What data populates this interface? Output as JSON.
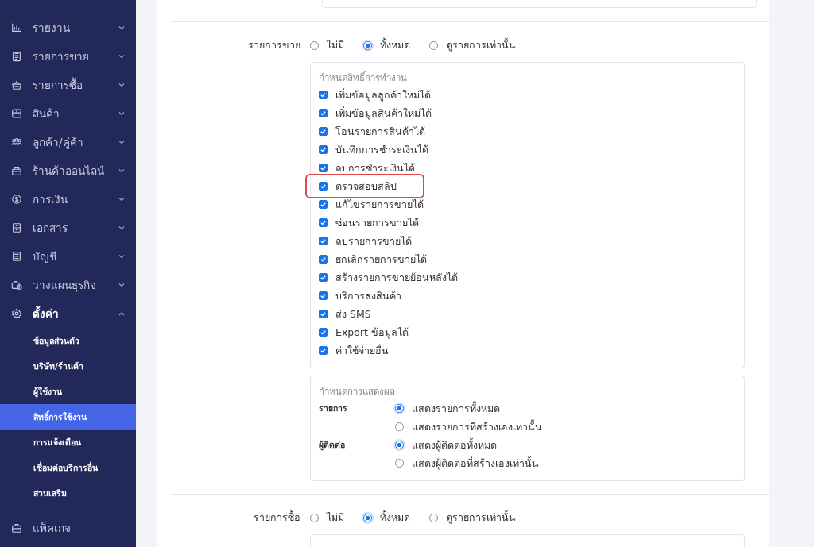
{
  "sidebar": {
    "items": [
      {
        "label": "รายงาน",
        "expanded": false
      },
      {
        "label": "รายการขาย",
        "expanded": false
      },
      {
        "label": "รายการซื้อ",
        "expanded": false
      },
      {
        "label": "สินค้า",
        "expanded": false
      },
      {
        "label": "ลูกค้า/คู่ค้า",
        "expanded": false
      },
      {
        "label": "ร้านค้าออนไลน์",
        "expanded": false
      },
      {
        "label": "การเงิน",
        "expanded": false
      },
      {
        "label": "เอกสาร",
        "expanded": false
      },
      {
        "label": "บัญชี",
        "expanded": false
      },
      {
        "label": "วางแผนธุรกิจ",
        "expanded": false
      },
      {
        "label": "ตั้งค่า",
        "expanded": true,
        "children": [
          {
            "label": "ข้อมูลส่วนตัว",
            "selected": false
          },
          {
            "label": "บริษัท/ร้านค้า",
            "selected": false
          },
          {
            "label": "ผู้ใช้งาน",
            "selected": false
          },
          {
            "label": "สิทธิ์การใช้งาน",
            "selected": true
          },
          {
            "label": "การแจ้งเตือน",
            "selected": false
          },
          {
            "label": "เชื่อมต่อบริการอื่น",
            "selected": false
          },
          {
            "label": "ส่วนเสริม",
            "selected": false
          }
        ]
      },
      {
        "label": "แพ็คเกจ"
      }
    ]
  },
  "sections": [
    {
      "label": "รายการขาย",
      "options": [
        {
          "label": "ไม่มี",
          "selected": false
        },
        {
          "label": "ทั้งหมด",
          "selected": true
        },
        {
          "label": "ดูรายการเท่านั้น",
          "selected": false
        }
      ],
      "permissions": {
        "title": "กำหนดสิทธิ์การทำงาน",
        "items": [
          {
            "label": "เพิ่มข้อมูลลูกค้าใหม่ได้",
            "checked": true,
            "highlighted": false
          },
          {
            "label": "เพิ่มข้อมูลสินค้าใหม่ได้",
            "checked": true,
            "highlighted": false
          },
          {
            "label": "โอนรายการสินค้าได้",
            "checked": true,
            "highlighted": false
          },
          {
            "label": "บันทึกการชำระเงินได้",
            "checked": true,
            "highlighted": false
          },
          {
            "label": "ลบการชำระเงินได้",
            "checked": true,
            "highlighted": false
          },
          {
            "label": "ตรวจสอบสลิป",
            "checked": true,
            "highlighted": true
          },
          {
            "label": "แก้ไขรายการขายได้",
            "checked": true,
            "highlighted": false
          },
          {
            "label": "ซ่อนรายการขายได้",
            "checked": true,
            "highlighted": false
          },
          {
            "label": "ลบรายการขายได้",
            "checked": true,
            "highlighted": false
          },
          {
            "label": "ยกเลิกรายการขายได้",
            "checked": true,
            "highlighted": false
          },
          {
            "label": "สร้างรายการขายย้อนหลังได้",
            "checked": true,
            "highlighted": false
          },
          {
            "label": "บริการส่งสินค้า",
            "checked": true,
            "highlighted": false
          },
          {
            "label": "ส่ง SMS",
            "checked": true,
            "highlighted": false
          },
          {
            "label": "Export ข้อมูลได้",
            "checked": true,
            "highlighted": false
          },
          {
            "label": "ค่าใช้จ่ายอื่น",
            "checked": true,
            "highlighted": false
          }
        ]
      },
      "display": {
        "title": "กำหนดการแสดงผล",
        "groups": [
          {
            "label": "รายการ",
            "options": [
              {
                "label": "แสดงรายการทั้งหมด",
                "selected": true
              },
              {
                "label": "แสดงรายการที่สร้างเองเท่านั้น",
                "selected": false
              }
            ]
          },
          {
            "label": "ผู้ติดต่อ",
            "options": [
              {
                "label": "แสดงผู้ติดต่อทั้งหมด",
                "selected": true
              },
              {
                "label": "แสดงผู้ติดต่อที่สร้างเองเท่านั้น",
                "selected": false
              }
            ]
          }
        ]
      }
    },
    {
      "label": "รายการซื้อ",
      "options": [
        {
          "label": "ไม่มี",
          "selected": false
        },
        {
          "label": "ทั้งหมด",
          "selected": true
        },
        {
          "label": "ดูรายการเท่านั้น",
          "selected": false
        }
      ]
    }
  ]
}
